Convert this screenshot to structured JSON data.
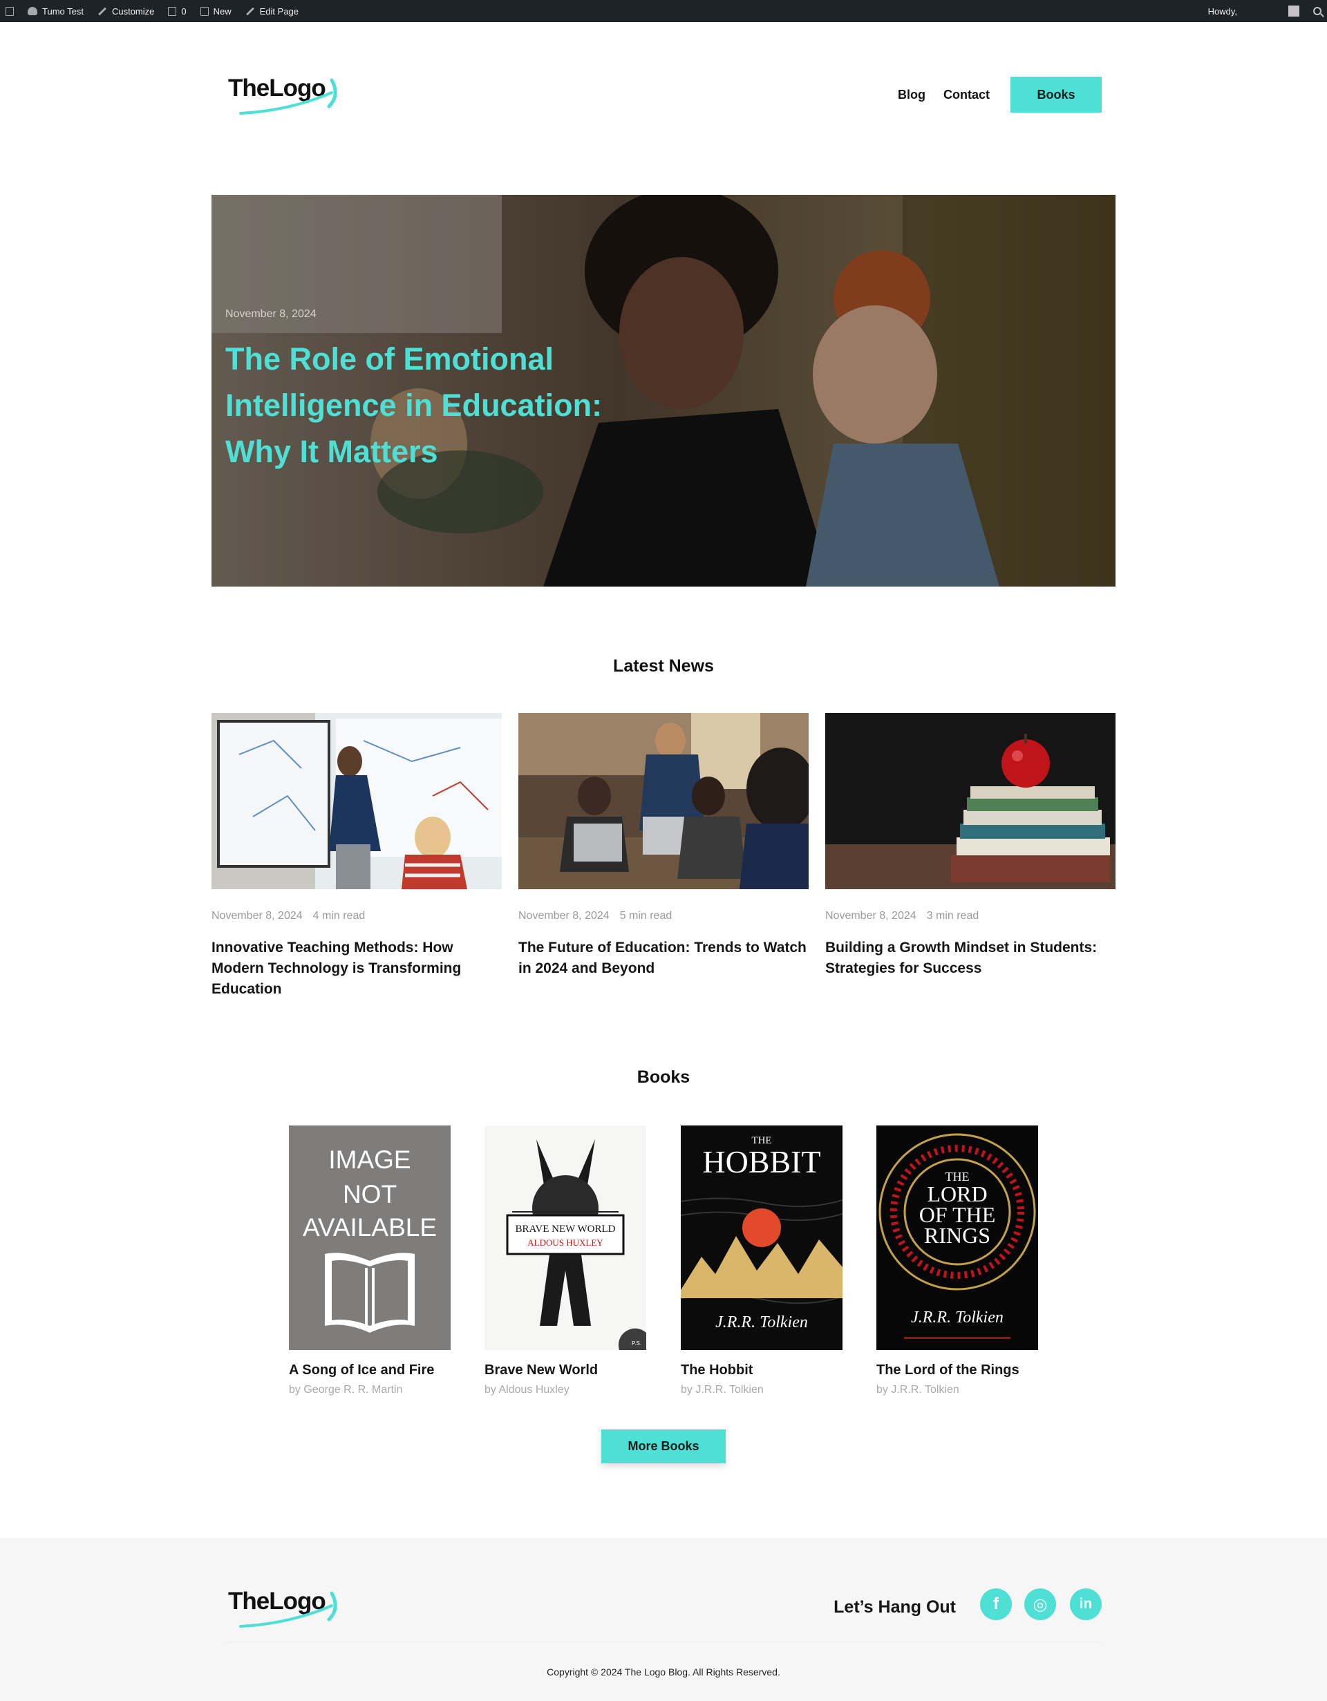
{
  "admin_bar": {
    "site_name": "Tumo Test",
    "customize": "Customize",
    "comments_count": "0",
    "new_label": "New",
    "edit_page": "Edit Page",
    "howdy": "Howdy,"
  },
  "header": {
    "logo": "TheLogo",
    "nav": [
      {
        "label": "Blog"
      },
      {
        "label": "Contact"
      }
    ],
    "cta_label": "Books"
  },
  "hero": {
    "date": "November 8, 2024",
    "title": "The Role of Emotional Intelligence in Education: Why It Matters"
  },
  "latest_news": {
    "title": "Latest News",
    "items": [
      {
        "date": "November 8, 2024",
        "read_time": "4 min read",
        "title": "Innovative Teaching Methods: How Modern Technology is Transforming Education"
      },
      {
        "date": "November 8, 2024",
        "read_time": "5 min read",
        "title": "The Future of Education: Trends to Watch in 2024 and Beyond"
      },
      {
        "date": "November 8, 2024",
        "read_time": "3 min read",
        "title": "Building a Growth Mindset in Students: Strategies for Success"
      }
    ]
  },
  "books": {
    "title": "Books",
    "items": [
      {
        "title": "A Song of Ice and Fire",
        "author": "by George R. R. Martin",
        "cover_text": [
          "IMAGE",
          "NOT",
          "AVAILABLE"
        ]
      },
      {
        "title": "Brave New World",
        "author": "by Aldous Huxley",
        "cover_text": [
          "BRAVE NEW WORLD",
          "ALDOUS HUXLEY",
          "P.S."
        ]
      },
      {
        "title": "The Hobbit",
        "author": "by J.R.R. Tolkien",
        "cover_text": [
          "THE",
          "HOBBIT",
          "J.R.R. Tolkien"
        ]
      },
      {
        "title": "The Lord of the Rings",
        "author": "by J.R.R. Tolkien",
        "cover_text": [
          "THE",
          "LORD",
          "OF THE",
          "RINGS",
          "J.R.R. Tolkien"
        ]
      }
    ],
    "more_label": "More Books"
  },
  "footer": {
    "logo": "TheLogo",
    "hangout": "Let’s Hang Out",
    "social": [
      {
        "icon": "facebook-icon",
        "glyph": "f"
      },
      {
        "icon": "instagram-icon",
        "glyph": "◎"
      },
      {
        "icon": "linkedin-icon",
        "glyph": "in"
      }
    ],
    "copyright": "Copyright © 2024 The Logo Blog. All Rights Reserved."
  },
  "colors": {
    "accent": "#4fe0d5",
    "admin_bar": "#1d2327",
    "footer_bg": "#f6f6f6"
  }
}
